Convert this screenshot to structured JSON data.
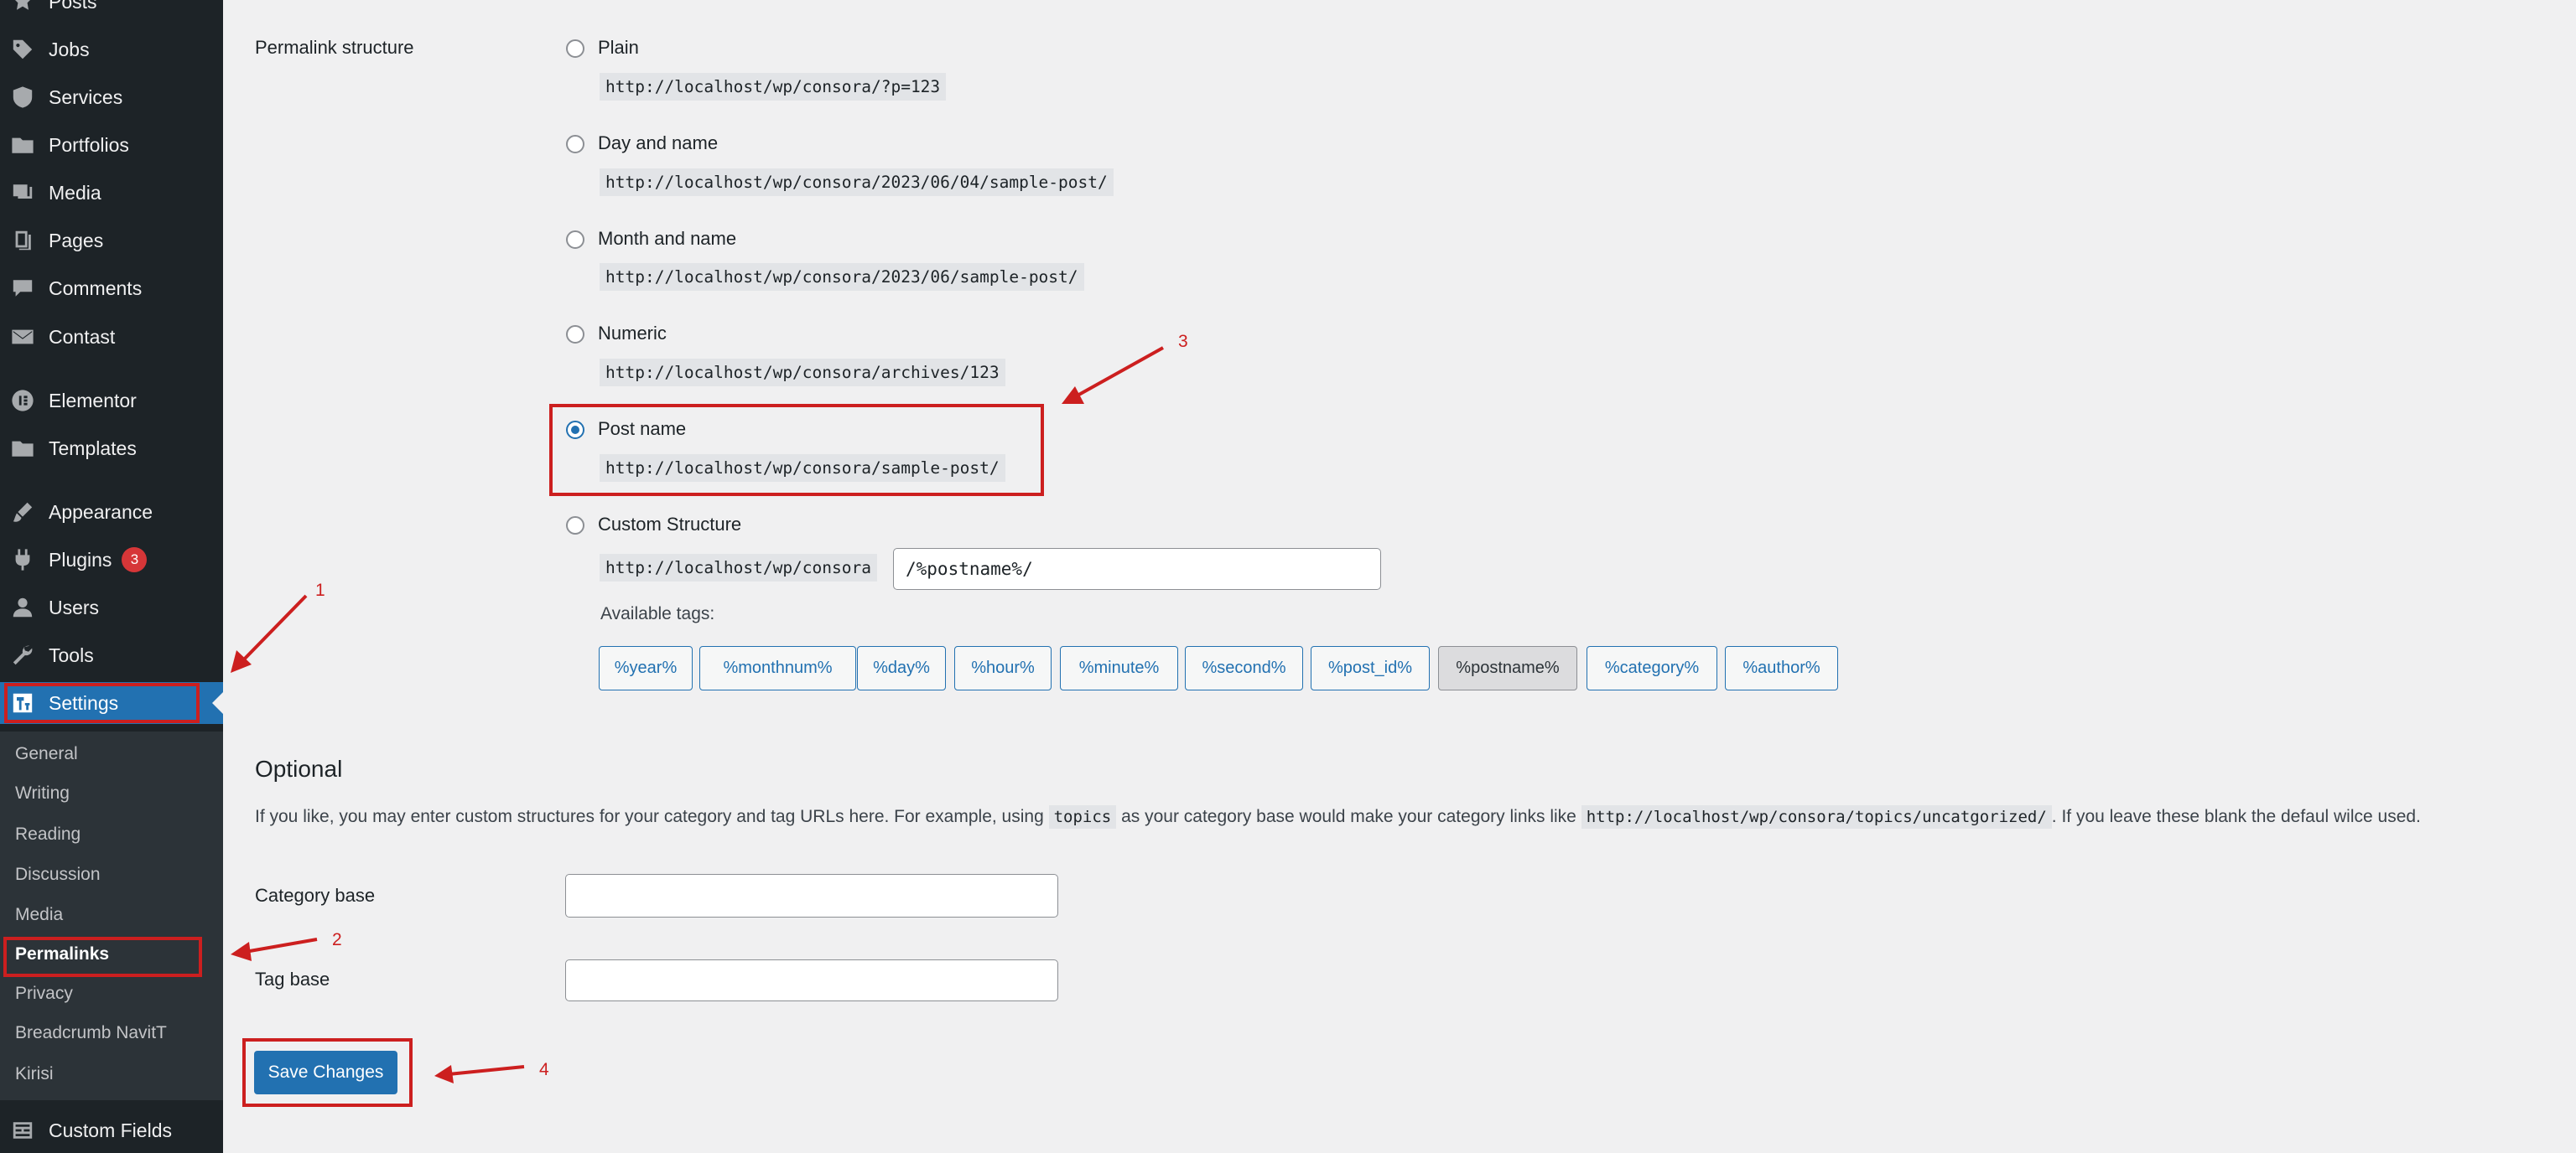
{
  "sidebar": {
    "items": [
      {
        "label": "Posts",
        "icon": "pin-icon"
      },
      {
        "label": "Jobs",
        "icon": "tag-icon"
      },
      {
        "label": "Services",
        "icon": "shield-icon"
      },
      {
        "label": "Portfolios",
        "icon": "folder-icon"
      },
      {
        "label": "Media",
        "icon": "media-icon"
      },
      {
        "label": "Pages",
        "icon": "pages-icon"
      },
      {
        "label": "Comments",
        "icon": "comment-icon"
      },
      {
        "label": "Contast",
        "icon": "mail-icon"
      },
      {
        "label": "Elementor",
        "icon": "elementor-icon"
      },
      {
        "label": "Templates",
        "icon": "folder-icon"
      },
      {
        "label": "Appearance",
        "icon": "brush-icon"
      },
      {
        "label": "Plugins",
        "icon": "plugin-icon",
        "badge": "3"
      },
      {
        "label": "Users",
        "icon": "user-icon"
      },
      {
        "label": "Tools",
        "icon": "wrench-icon"
      },
      {
        "label": "Settings",
        "icon": "settings-icon"
      },
      {
        "label": "Custom Fields",
        "icon": "fields-icon"
      }
    ],
    "submenu": [
      "General",
      "Writing",
      "Reading",
      "Discussion",
      "Media",
      "Permalinks",
      "Privacy",
      "Breadcrumb NavitT",
      "Kirisi"
    ]
  },
  "permalink": {
    "heading": "Permalink structure",
    "options": [
      {
        "label": "Plain",
        "url": "http://localhost/wp/consora/?p=123",
        "checked": false
      },
      {
        "label": "Day and name",
        "url": "http://localhost/wp/consora/2023/06/04/sample-post/",
        "checked": false
      },
      {
        "label": "Month and name",
        "url": "http://localhost/wp/consora/2023/06/sample-post/",
        "checked": false
      },
      {
        "label": "Numeric",
        "url": "http://localhost/wp/consora/archives/123",
        "checked": false
      },
      {
        "label": "Post name",
        "url": "http://localhost/wp/consora/sample-post/",
        "checked": true
      },
      {
        "label": "Custom Structure",
        "url": "http://localhost/wp/consora",
        "checked": false
      }
    ],
    "custom_value": "/%postname%/",
    "available_tags_label": "Available tags:",
    "tags": [
      "%year%",
      "%monthnum%",
      "%day%",
      "%hour%",
      "%minute%",
      "%second%",
      "%post_id%",
      "%postname%",
      "%category%",
      "%author%"
    ]
  },
  "optional": {
    "heading": "Optional",
    "desc_part1": "If you like, you may enter custom structures for your category and tag URLs here. For example, using",
    "desc_code1": "topics",
    "desc_part2": "as your category base would make your category links like",
    "desc_code2": "http://localhost/wp/consora/topics/uncatgorized/",
    "desc_part3": ". If you leave these blank the defaul wilce used.",
    "category_base_label": "Category base",
    "tag_base_label": "Tag base"
  },
  "save_label": "Save Changes",
  "annotations": [
    "1",
    "2",
    "3",
    "4"
  ],
  "colors": {
    "accent": "#2271b1",
    "annotation": "#cc1f1f",
    "sidebar": "#1d2327",
    "badge": "#d63638"
  }
}
